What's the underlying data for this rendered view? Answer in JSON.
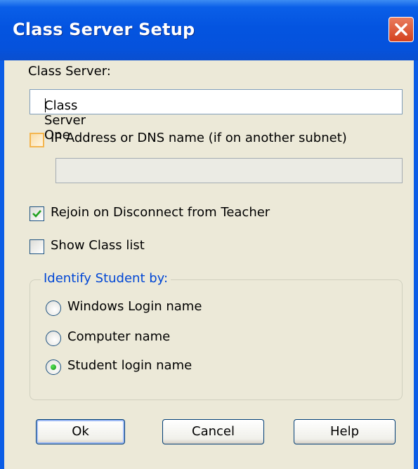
{
  "window": {
    "title": "Class Server Setup"
  },
  "form": {
    "class_server_label": "Class Server:",
    "class_server_value": "Class Server One",
    "ip_checkbox_label": "IP Address or DNS name (if on another subnet)",
    "ip_checkbox_checked": false,
    "ip_field_value": "",
    "rejoin_label": "Rejoin on Disconnect from Teacher",
    "rejoin_checked": true,
    "show_class_list_label": "Show Class list",
    "show_class_list_checked": false
  },
  "identify": {
    "group_title": "Identify Student by:",
    "options": [
      {
        "label": "Windows Login name",
        "selected": false
      },
      {
        "label": "Computer name",
        "selected": false
      },
      {
        "label": "Student login name",
        "selected": true
      }
    ]
  },
  "buttons": {
    "ok": "Ok",
    "cancel": "Cancel",
    "help": "Help"
  },
  "colors": {
    "titlebar": "#0454e0",
    "dialog_bg": "#ece9d8",
    "group_title": "#0046d5",
    "close_button": "#d4421e"
  },
  "icons": {
    "close": "close-x-icon",
    "check": "checkmark-icon",
    "radio_dot": "radio-selected-dot"
  }
}
